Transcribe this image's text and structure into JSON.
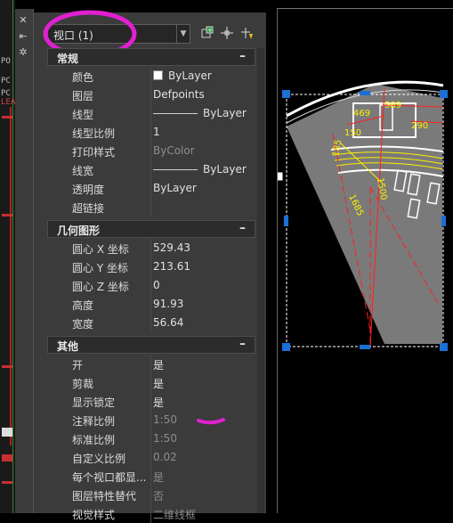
{
  "left_strip": {
    "texts": [
      "PO",
      "PC",
      "PC",
      "LEA"
    ]
  },
  "tools": {
    "pin_icon": "pin-icon",
    "settings_icon": "settings-icon"
  },
  "header": {
    "selector_value": "视口 (1)",
    "toolbar_icons": [
      "quick-select-icon",
      "select-objects-icon",
      "toggle-pickadd-icon"
    ]
  },
  "sections": {
    "general": {
      "title": "常规",
      "toggle": "–",
      "rows": [
        {
          "label": "颜色",
          "value": "ByLayer",
          "swatch": "#ffffff"
        },
        {
          "label": "图层",
          "value": "Defpoints"
        },
        {
          "label": "线型",
          "value": "ByLayer"
        },
        {
          "label": "线型比例",
          "value": "1"
        },
        {
          "label": "打印样式",
          "value": "ByColor"
        },
        {
          "label": "线宽",
          "value": "ByLayer"
        },
        {
          "label": "透明度",
          "value": "ByLayer"
        },
        {
          "label": "超链接",
          "value": ""
        }
      ]
    },
    "geometry": {
      "title": "几何图形",
      "toggle": "–",
      "rows": [
        {
          "label": "圆心 X 坐标",
          "value": "529.43"
        },
        {
          "label": "圆心 Y 坐标",
          "value": "213.61"
        },
        {
          "label": "圆心 Z 坐标",
          "value": "0"
        },
        {
          "label": "高度",
          "value": "91.93"
        },
        {
          "label": "宽度",
          "value": "56.64"
        }
      ]
    },
    "misc": {
      "title": "其他",
      "toggle": "–",
      "rows": [
        {
          "label": "开",
          "value": "是"
        },
        {
          "label": "剪裁",
          "value": "是"
        },
        {
          "label": "显示锁定",
          "value": "是"
        },
        {
          "label": "注释比例",
          "value": "1:50"
        },
        {
          "label": "标准比例",
          "value": "1:50"
        },
        {
          "label": "自定义比例",
          "value": "0.02"
        },
        {
          "label": "每个视口都显...",
          "value": "是"
        },
        {
          "label": "图层特性替代",
          "value": "否"
        },
        {
          "label": "视觉样式",
          "value": "二维线框"
        }
      ]
    }
  },
  "drawing": {
    "dimensions": [
      "589",
      "469",
      "290",
      "150",
      "185",
      "1685",
      "1500"
    ],
    "colors": {
      "accent_magenta": "#e020d0",
      "grip_blue": "#1b6fd6",
      "dim_red": "#ff2020",
      "dim_yellow": "#ffee00"
    }
  }
}
